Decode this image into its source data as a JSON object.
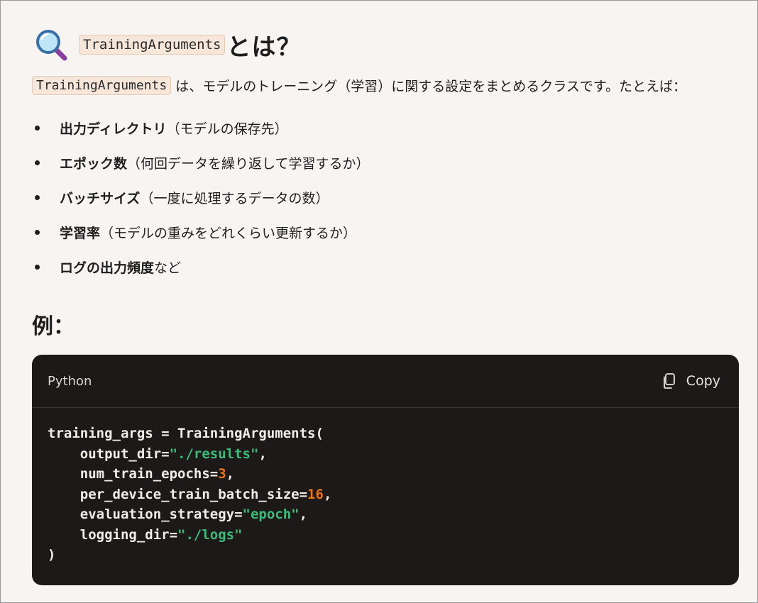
{
  "heading": {
    "code": "TrainingArguments",
    "text": "とは？"
  },
  "intro": {
    "code": "TrainingArguments",
    "text": "は、モデルのトレーニング（学習）に関する設定をまとめるクラスです。たとえば："
  },
  "bullets": [
    {
      "bold": "出力ディレクトリ",
      "rest": "（モデルの保存先）"
    },
    {
      "bold": "エポック数",
      "rest": "（何回データを繰り返して学習するか）"
    },
    {
      "bold": "バッチサイズ",
      "rest": "（一度に処理するデータの数）"
    },
    {
      "bold": "学習率",
      "rest": "（モデルの重みをどれくらい更新するか）"
    },
    {
      "bold": "ログの出力頻度",
      "rest": "など"
    }
  ],
  "example_heading": "例：",
  "code_block": {
    "language": "Python",
    "copy_label": "Copy",
    "line1": "training_args = TrainingArguments(",
    "l2_key": "    output_dir=",
    "l2_val": "\"./results\"",
    "l2_end": ",",
    "l3_key": "    num_train_epochs=",
    "l3_val": "3",
    "l3_end": ",",
    "l4_key": "    per_device_train_batch_size=",
    "l4_val": "16",
    "l4_end": ",",
    "l5_key": "    evaluation_strategy=",
    "l5_val": "\"epoch\"",
    "l5_end": ",",
    "l6_key": "    logging_dir=",
    "l6_val": "\"./logs\"",
    "line7": ")"
  },
  "icons": {
    "heading_icon": "magnifying-glass-icon",
    "copy_icon": "copy-icon"
  },
  "colors": {
    "background": "#f8f4f1",
    "code_bg": "#1c1918",
    "string": "#3dbb7a",
    "number": "#e8741a"
  }
}
